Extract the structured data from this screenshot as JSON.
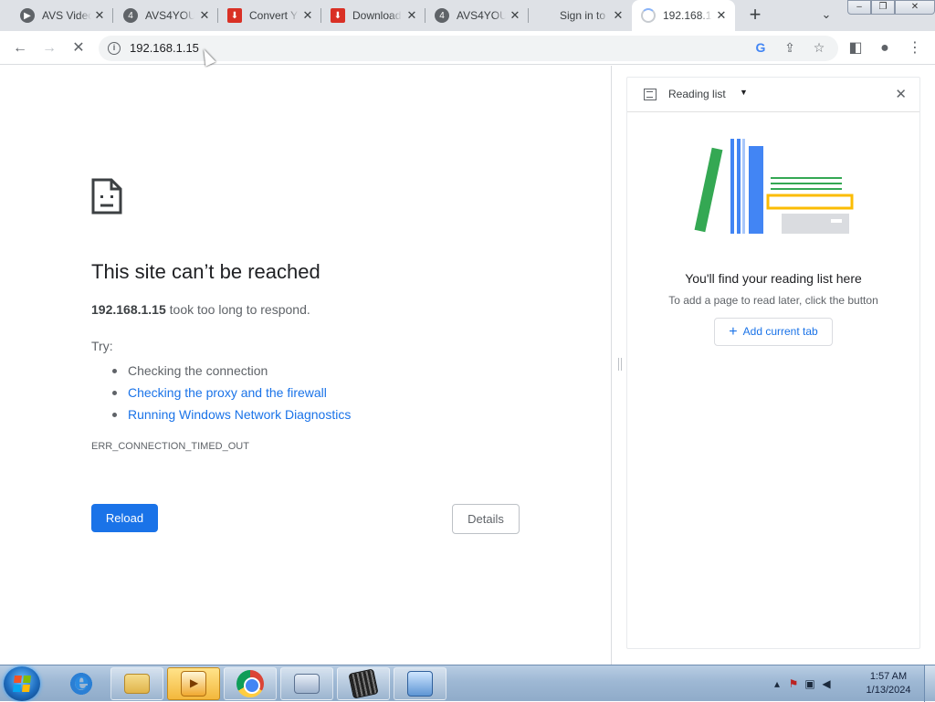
{
  "tabs": [
    {
      "title": "AVS Video",
      "favicon": "avs-icon"
    },
    {
      "title": "AVS4YOU",
      "favicon": "avs4you-icon"
    },
    {
      "title": "Convert Y",
      "favicon": "download-red-icon"
    },
    {
      "title": "Download",
      "favicon": "download-red-icon"
    },
    {
      "title": "AVS4YOU",
      "favicon": "avs4you-icon"
    },
    {
      "title": "Sign in to",
      "favicon": "microsoft-icon"
    },
    {
      "title": "192.168.1",
      "favicon": "loading-spinner-icon",
      "active": true
    }
  ],
  "address_bar": {
    "url": "192.168.1.15"
  },
  "error_page": {
    "title": "This site can’t be reached",
    "host": "192.168.1.15",
    "subtitle_rest": " took too long to respond.",
    "try_label": "Try:",
    "suggestions": [
      "Checking the connection",
      "Checking the proxy and the firewall",
      "Running Windows Network Diagnostics"
    ],
    "error_code": "ERR_CONNECTION_TIMED_OUT",
    "reload_label": "Reload",
    "details_label": "Details"
  },
  "side_panel": {
    "header_label": "Reading list",
    "empty_title": "You'll find your reading list here",
    "empty_desc": "To add a page to read later, click the button",
    "add_button_label": "Add current tab"
  },
  "taskbar": {
    "time": "1:57 AM",
    "date": "1/13/2024"
  },
  "colors": {
    "accent_blue": "#1a73e8",
    "tab_strip": "#dee1e6",
    "book_green": "#34a853",
    "book_blue": "#4285f4",
    "book_yellow": "#fbbc04"
  }
}
